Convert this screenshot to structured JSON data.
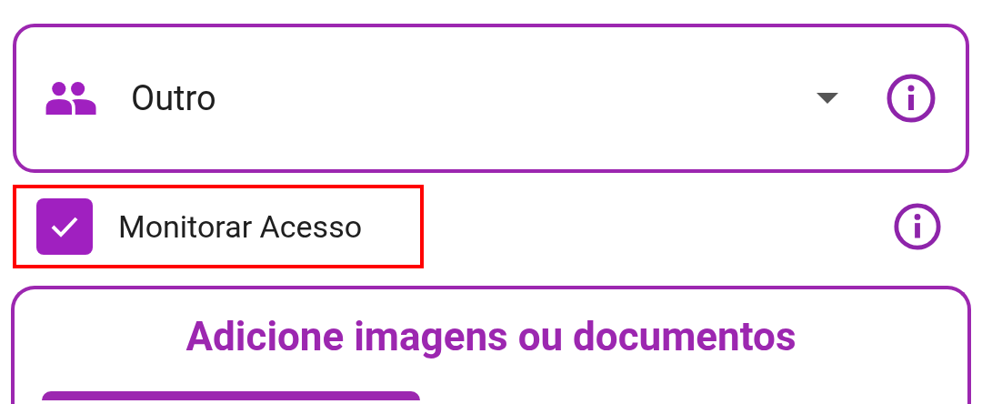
{
  "category_select": {
    "value": "Outro",
    "expanded": false
  },
  "monitor_access": {
    "label": "Monitorar Acesso",
    "checked": true,
    "highlighted": true
  },
  "attachments": {
    "title": "Adicione imagens ou documentos"
  }
}
